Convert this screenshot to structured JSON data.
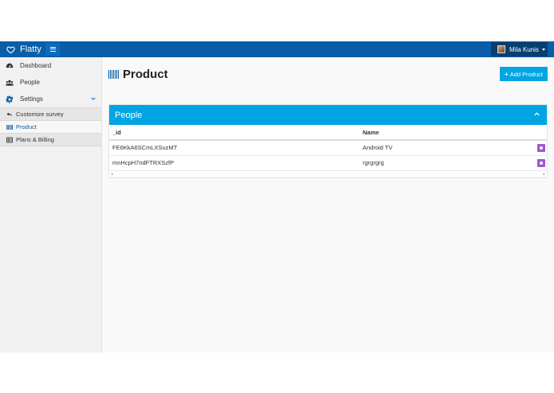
{
  "app": {
    "brand": "Flatty",
    "user_name": "Mila Kunis"
  },
  "sidebar": {
    "items": [
      {
        "label": "Dashboard",
        "icon": "dashboard-icon"
      },
      {
        "label": "People",
        "icon": "users-icon"
      },
      {
        "label": "Settings",
        "icon": "gear-icon"
      }
    ],
    "submenu": [
      {
        "label": "Customize survey",
        "icon": "back-arrow-icon"
      },
      {
        "label": "Product",
        "icon": "barcode-icon",
        "active": true
      },
      {
        "label": "Plans & Billing",
        "icon": "table-icon"
      }
    ]
  },
  "page": {
    "title": "Product",
    "add_button": "Add Product"
  },
  "box": {
    "title": "People",
    "columns": [
      "_id",
      "Name"
    ],
    "rows": [
      {
        "id": "FE6KkA6SCmLXSuzMT",
        "name": "Android TV"
      },
      {
        "id": "mnHcpH7ndFTRXSzfP",
        "name": "rgrgrgrg"
      }
    ]
  },
  "colors": {
    "topbar": "#0a5ea8",
    "accent": "#01a5e3",
    "info_button": "#9b59d0"
  }
}
